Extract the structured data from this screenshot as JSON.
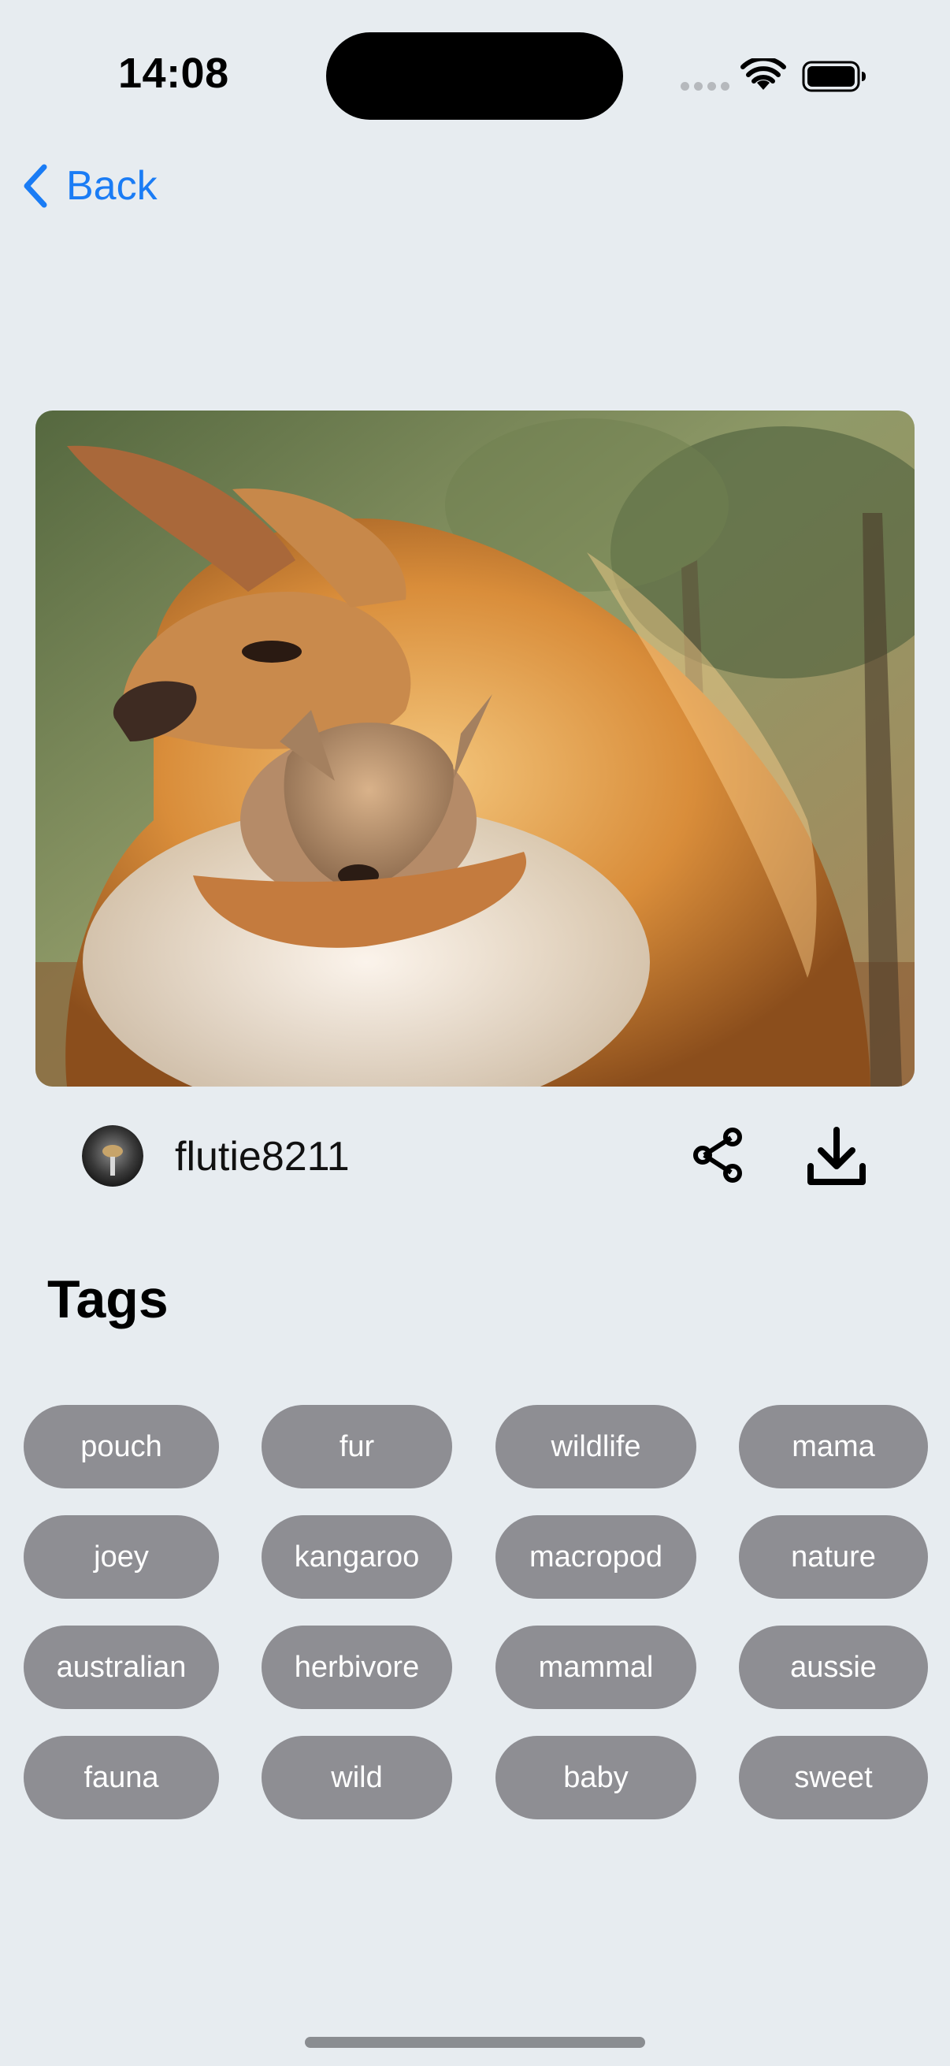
{
  "status_bar": {
    "time": "14:08"
  },
  "nav": {
    "back_label": "Back",
    "accent_color": "#1a7cf5"
  },
  "photo": {
    "subject": "kangaroo holding joey"
  },
  "author": {
    "username": "flutie8211"
  },
  "actions": {
    "share_icon": "share-icon",
    "download_icon": "download-icon"
  },
  "tags": {
    "heading": "Tags",
    "items": [
      "pouch",
      "fur",
      "wildlife",
      "mama",
      "joey",
      "kangaroo",
      "macropod",
      "nature",
      "australian",
      "herbivore",
      "mammal",
      "aussie",
      "fauna",
      "wild",
      "baby",
      "sweet"
    ],
    "chip_color": "#8e8e93"
  }
}
